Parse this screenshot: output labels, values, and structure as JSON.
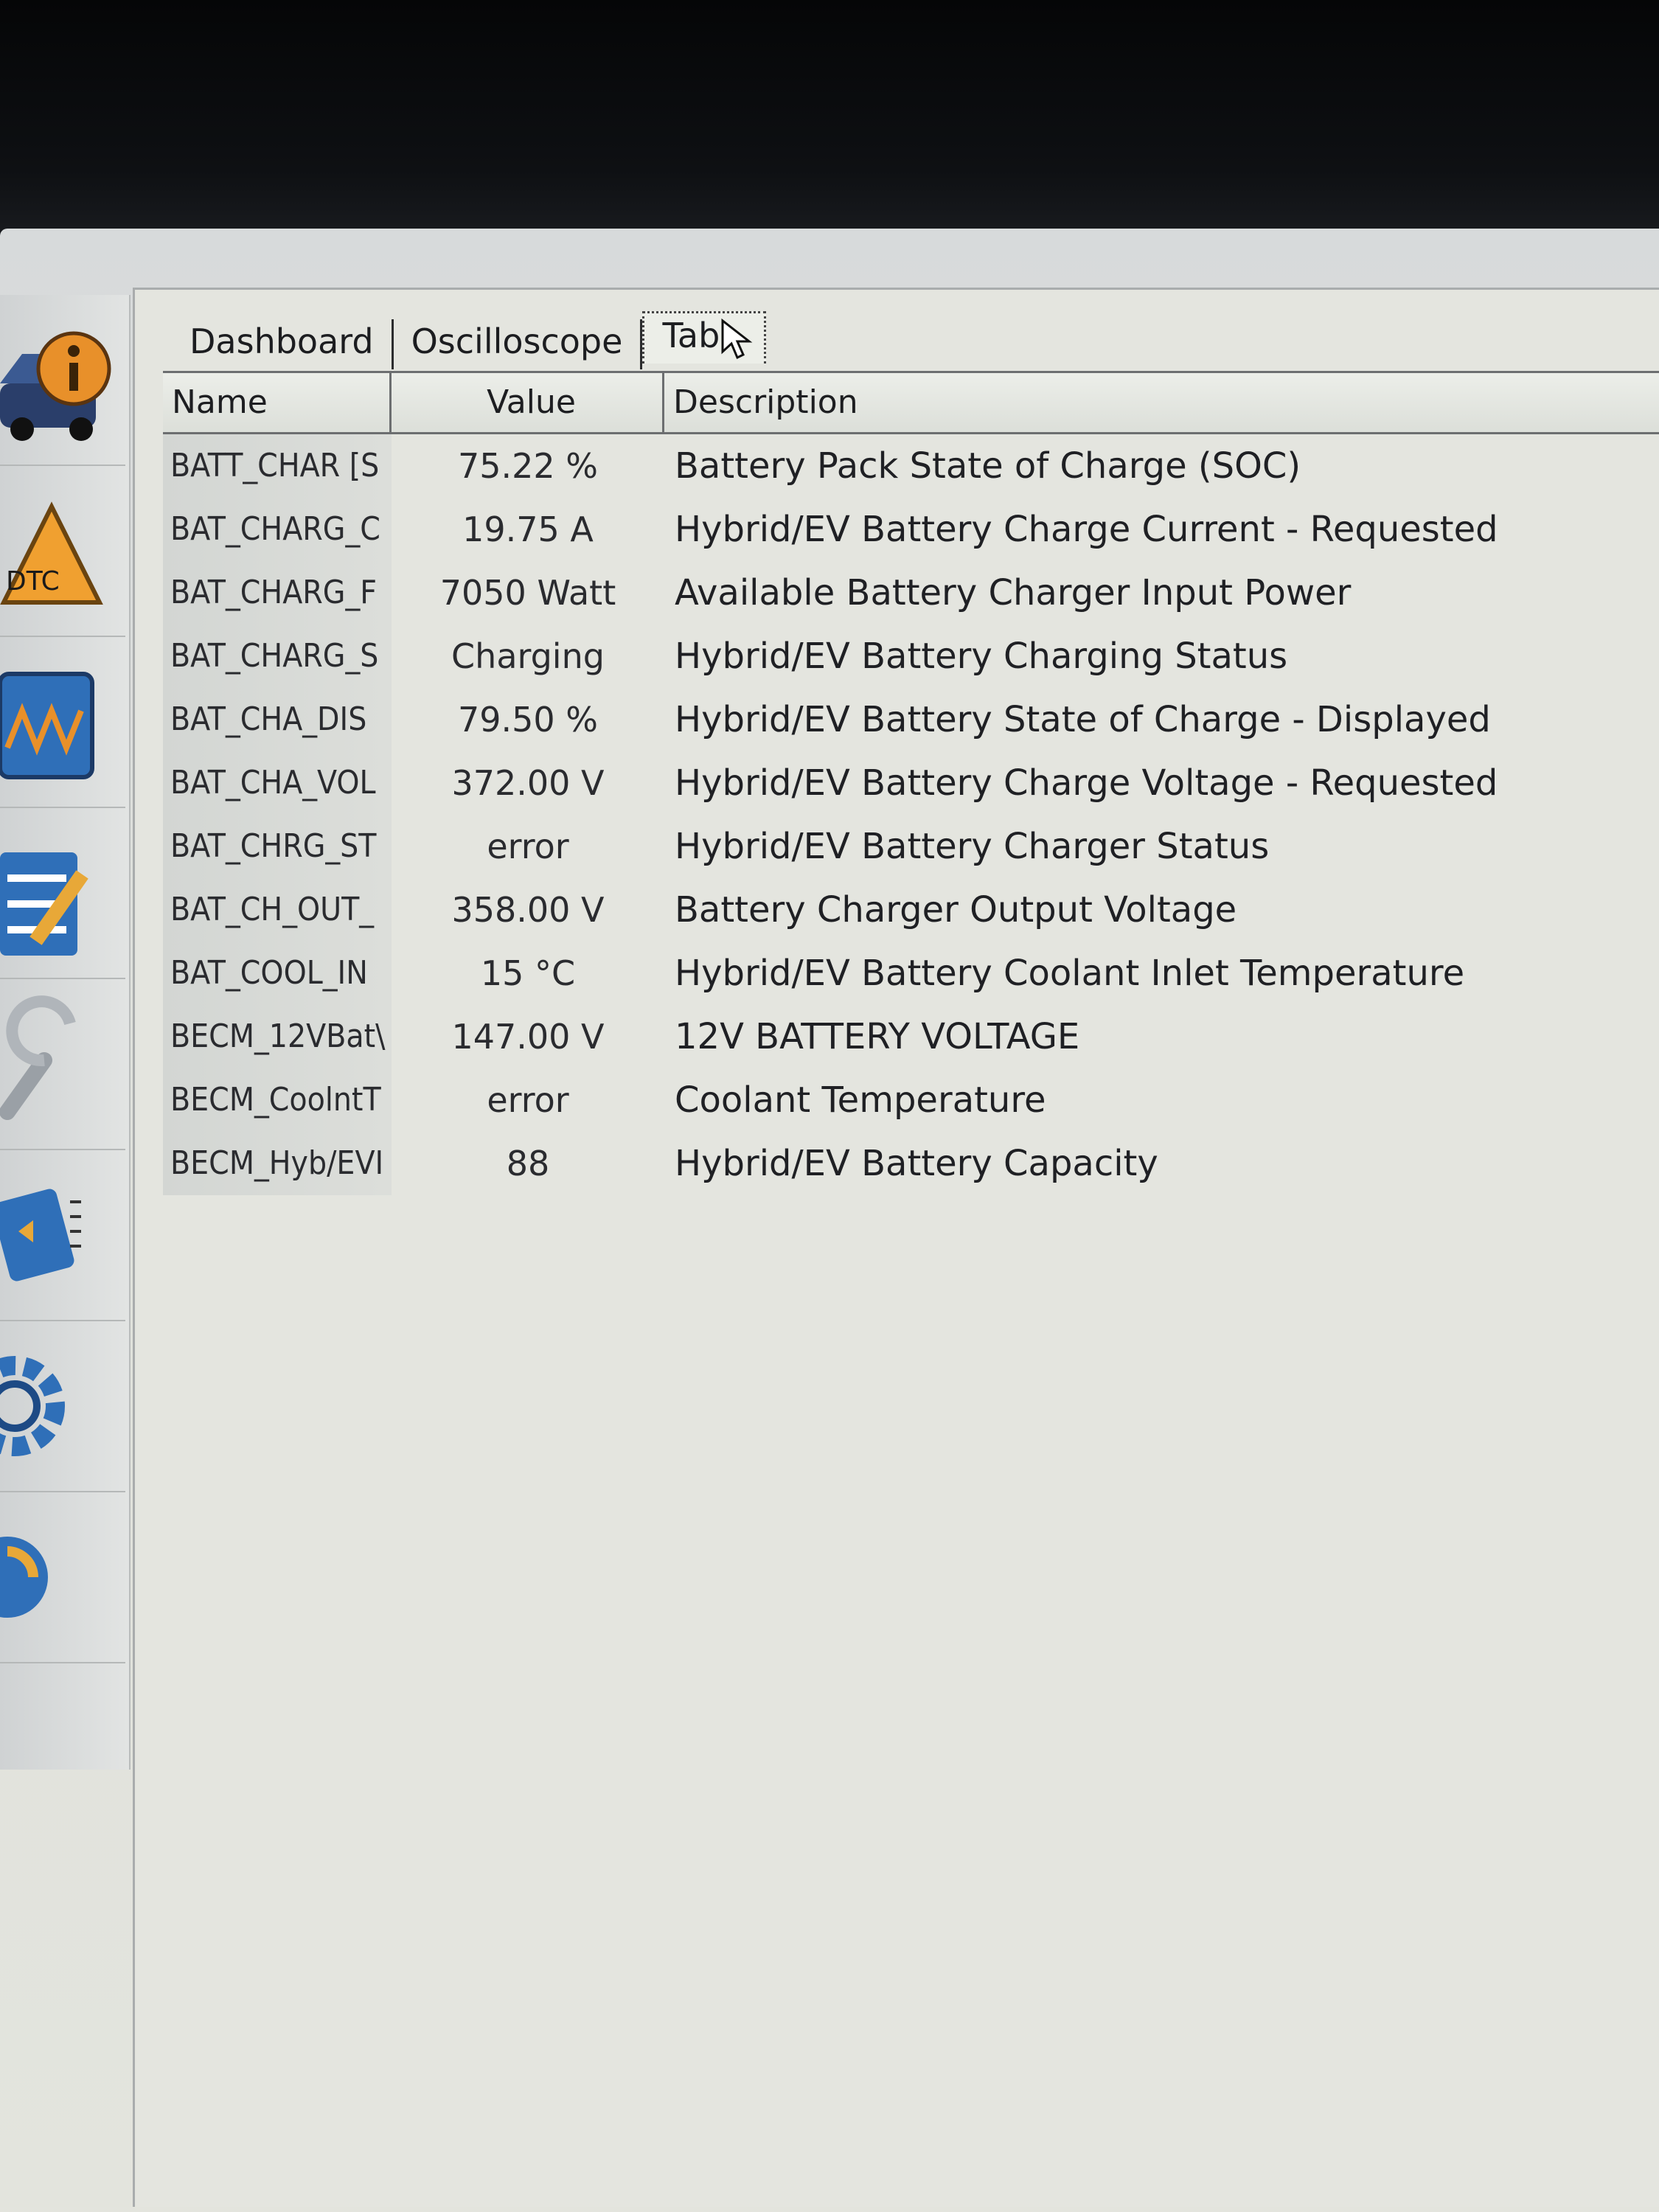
{
  "tabs": [
    {
      "label": "Dashboard",
      "active": false
    },
    {
      "label": "Oscilloscope",
      "active": false
    },
    {
      "label": "Tab",
      "active": true
    }
  ],
  "toolbar": {
    "items": [
      {
        "icon": "car-info-icon"
      },
      {
        "icon": "dtc-warning-icon",
        "label": "DTC"
      },
      {
        "icon": "oscilloscope-icon"
      },
      {
        "icon": "checklist-icon"
      },
      {
        "icon": "wrench-icon"
      },
      {
        "icon": "chip-icon"
      },
      {
        "icon": "gear-icon"
      },
      {
        "icon": "update-icon"
      }
    ]
  },
  "table": {
    "columns": {
      "name": "Name",
      "value": "Value",
      "description": "Description"
    },
    "rows": [
      {
        "name": "BATT_CHAR [S",
        "value": "75.22 %",
        "description": "Battery Pack State of Charge (SOC)"
      },
      {
        "name": "BAT_CHARG_C",
        "value": "19.75 A",
        "description": "Hybrid/EV Battery Charge Current - Requested"
      },
      {
        "name": "BAT_CHARG_F",
        "value": "7050 Watt",
        "description": "Available Battery Charger Input Power"
      },
      {
        "name": "BAT_CHARG_S",
        "value": "Charging",
        "description": "Hybrid/EV Battery Charging Status"
      },
      {
        "name": "BAT_CHA_DIS",
        "value": "79.50 %",
        "description": "Hybrid/EV Battery State of Charge - Displayed"
      },
      {
        "name": "BAT_CHA_VOL",
        "value": "372.00 V",
        "description": "Hybrid/EV Battery Charge Voltage - Requested"
      },
      {
        "name": "BAT_CHRG_ST",
        "value": "error",
        "description": "Hybrid/EV Battery Charger Status"
      },
      {
        "name": "BAT_CH_OUT_",
        "value": "358.00 V",
        "description": "Battery Charger Output Voltage"
      },
      {
        "name": "BAT_COOL_IN",
        "value": "15 °C",
        "description": "Hybrid/EV Battery Coolant Inlet Temperature"
      },
      {
        "name": "BECM_12VBat\\",
        "value": "147.00 V",
        "description": "12V BATTERY VOLTAGE"
      },
      {
        "name": "BECM_CoolntT",
        "value": "error",
        "description": "Coolant Temperature"
      },
      {
        "name": "BECM_Hyb/EVI",
        "value": "88",
        "description": "Hybrid/EV Battery Capacity"
      }
    ]
  },
  "colors": {
    "info_orange": "#e8902a",
    "dtc_orange": "#f0a030",
    "scope_blue": "#2f6fb8",
    "text": "#1f2024"
  }
}
